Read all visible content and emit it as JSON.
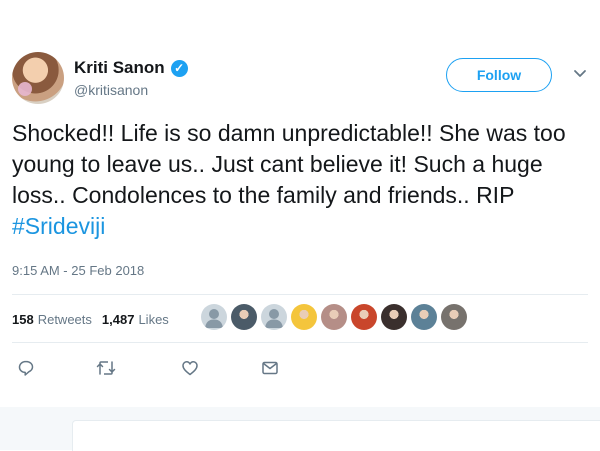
{
  "tweet": {
    "author": {
      "display_name": "Kriti Sanon",
      "handle": "@kritisanon",
      "verified_icon": "verified-badge-icon"
    },
    "follow_label": "Follow",
    "text_main": "Shocked!! Life is so damn unpredictable!! She was too young to leave us.. Just cant believe it! Such a huge loss.. Condolences to the family and friends.. RIP ",
    "hashtag": "#Srideviji",
    "timestamp": "9:15 AM - 25 Feb 2018",
    "stats": {
      "retweets_count": "158",
      "retweets_label": "Retweets",
      "likes_count": "1,487",
      "likes_label": "Likes"
    },
    "likers": [
      {
        "name": "default-avatar",
        "color": "#8899a6"
      },
      {
        "name": "user-photo",
        "color": "#4b5b68"
      },
      {
        "name": "default-avatar",
        "color": "#8899a6"
      },
      {
        "name": "user-photo",
        "color": "#f4c53c"
      },
      {
        "name": "user-photo",
        "color": "#b58e87"
      },
      {
        "name": "user-photo",
        "color": "#c9462b"
      },
      {
        "name": "user-photo",
        "color": "#3a2f2d"
      },
      {
        "name": "user-photo",
        "color": "#5c8197"
      },
      {
        "name": "user-photo",
        "color": "#77726d"
      }
    ],
    "actions": [
      "reply-icon",
      "retweet-icon",
      "like-icon",
      "direct-message-icon"
    ]
  },
  "colors": {
    "brand_blue": "#1da1f2",
    "link_blue": "#1b95e0",
    "text_primary": "#14171a",
    "text_secondary": "#657786",
    "divider": "#e6ecf0"
  }
}
